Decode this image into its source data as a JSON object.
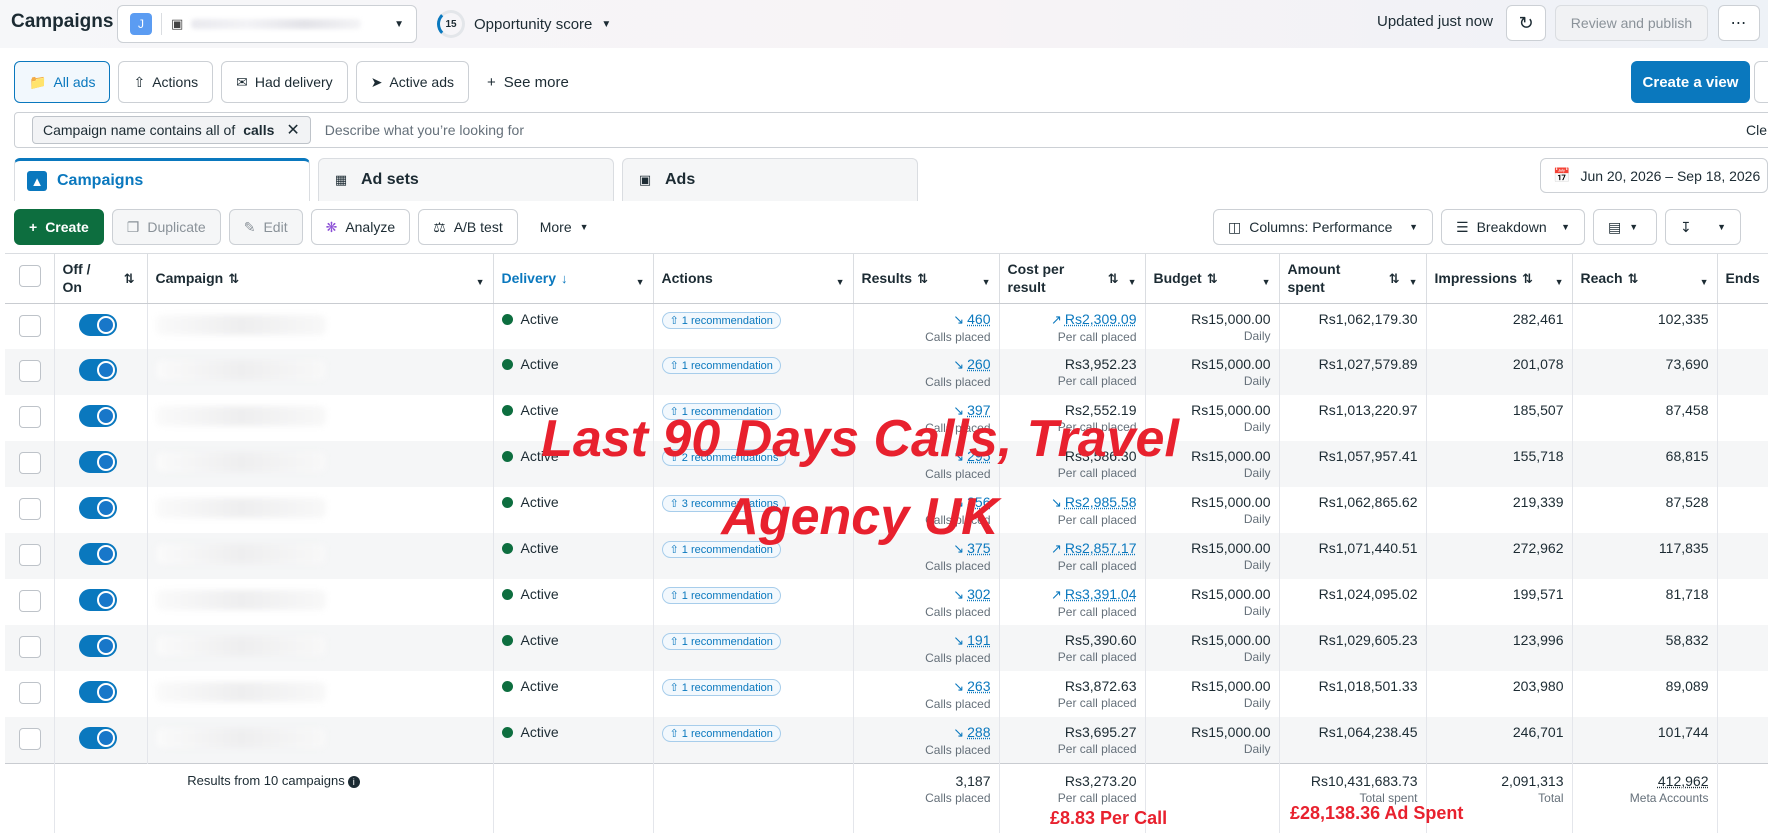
{
  "header": {
    "title": "Campaigns",
    "account_initial": "J",
    "opportunity_score": "15",
    "opportunity_label": "Opportunity score",
    "updated": "Updated just now",
    "review_label": "Review and publish",
    "more_label": "⋯"
  },
  "views": {
    "items": [
      {
        "label": "All ads"
      },
      {
        "label": "Actions"
      },
      {
        "label": "Had delivery"
      },
      {
        "label": "Active ads"
      }
    ],
    "see_more": "See more",
    "create_view": "Create a view"
  },
  "filter": {
    "chip_prefix": "Campaign name contains all of",
    "chip_value": "calls",
    "placeholder": "Describe what you’re looking for",
    "clear": "Cle"
  },
  "level_tabs": [
    {
      "label": "Campaigns"
    },
    {
      "label": "Ad sets"
    },
    {
      "label": "Ads"
    }
  ],
  "date_range": "Jun 20, 2026 – Sep 18, 2026",
  "toolbar": {
    "create": "Create",
    "duplicate": "Duplicate",
    "edit": "Edit",
    "analyze": "Analyze",
    "ab_test": "A/B test",
    "more": "More",
    "columns": "Columns: Performance",
    "breakdown": "Breakdown"
  },
  "table": {
    "headers": {
      "off_on": "Off / On",
      "campaign": "Campaign",
      "delivery": "Delivery",
      "actions": "Actions",
      "results": "Results",
      "cost": "Cost per result",
      "budget": "Budget",
      "amount": "Amount spent",
      "impressions": "Impressions",
      "reach": "Reach",
      "ends": "Ends"
    },
    "rows": [
      {
        "delivery": "Active",
        "actions": "1 recommendation",
        "results": "460",
        "results_sub": "Calls placed",
        "cost": "Rs2,309.09",
        "cost_sub": "Per call placed",
        "budget": "Rs15,000.00",
        "budget_sub": "Daily",
        "amount": "Rs1,062,179.30",
        "impressions": "282,461",
        "reach": "102,335"
      },
      {
        "delivery": "Active",
        "actions": "1 recommendation",
        "results": "260",
        "results_sub": "Calls placed",
        "cost": "Rs3,952.23",
        "cost_sub": "Per call placed",
        "budget": "Rs15,000.00",
        "budget_sub": "Daily",
        "amount": "Rs1,027,579.89",
        "impressions": "201,078",
        "reach": "73,690"
      },
      {
        "delivery": "Active",
        "actions": "1 recommendation",
        "results": "397",
        "results_sub": "Calls placed",
        "cost": "Rs2,552.19",
        "cost_sub": "Per call placed",
        "budget": "Rs15,000.00",
        "budget_sub": "Daily",
        "amount": "Rs1,013,220.97",
        "impressions": "185,507",
        "reach": "87,458"
      },
      {
        "delivery": "Active",
        "actions": "2 recommendations",
        "results": "295",
        "results_sub": "Calls placed",
        "cost": "Rs3,586.30",
        "cost_sub": "Per call placed",
        "budget": "Rs15,000.00",
        "budget_sub": "Daily",
        "amount": "Rs1,057,957.41",
        "impressions": "155,718",
        "reach": "68,815"
      },
      {
        "delivery": "Active",
        "actions": "3 recommendations",
        "results": "356",
        "results_sub": "Calls placed",
        "cost": "Rs2,985.58",
        "cost_sub": "Per call placed",
        "budget": "Rs15,000.00",
        "budget_sub": "Daily",
        "amount": "Rs1,062,865.62",
        "impressions": "219,339",
        "reach": "87,528"
      },
      {
        "delivery": "Active",
        "actions": "1 recommendation",
        "results": "375",
        "results_sub": "Calls placed",
        "cost": "Rs2,857.17",
        "cost_sub": "Per call placed",
        "budget": "Rs15,000.00",
        "budget_sub": "Daily",
        "amount": "Rs1,071,440.51",
        "impressions": "272,962",
        "reach": "117,835"
      },
      {
        "delivery": "Active",
        "actions": "1 recommendation",
        "results": "302",
        "results_sub": "Calls placed",
        "cost": "Rs3,391.04",
        "cost_sub": "Per call placed",
        "budget": "Rs15,000.00",
        "budget_sub": "Daily",
        "amount": "Rs1,024,095.02",
        "impressions": "199,571",
        "reach": "81,718"
      },
      {
        "delivery": "Active",
        "actions": "1 recommendation",
        "results": "191",
        "results_sub": "Calls placed",
        "cost": "Rs5,390.60",
        "cost_sub": "Per call placed",
        "budget": "Rs15,000.00",
        "budget_sub": "Daily",
        "amount": "Rs1,029,605.23",
        "impressions": "123,996",
        "reach": "58,832"
      },
      {
        "delivery": "Active",
        "actions": "1 recommendation",
        "results": "263",
        "results_sub": "Calls placed",
        "cost": "Rs3,872.63",
        "cost_sub": "Per call placed",
        "budget": "Rs15,000.00",
        "budget_sub": "Daily",
        "amount": "Rs1,018,501.33",
        "impressions": "203,980",
        "reach": "89,089"
      },
      {
        "delivery": "Active",
        "actions": "1 recommendation",
        "results": "288",
        "results_sub": "Calls placed",
        "cost": "Rs3,695.27",
        "cost_sub": "Per call placed",
        "budget": "Rs15,000.00",
        "budget_sub": "Daily",
        "amount": "Rs1,064,238.45",
        "impressions": "246,701",
        "reach": "101,744"
      }
    ],
    "summary": {
      "label": "Results from 10 campaigns",
      "results": "3,187",
      "results_sub": "Calls placed",
      "cost": "Rs3,273.20",
      "cost_sub": "Per call placed",
      "amount": "Rs10,431,683.73",
      "amount_sub": "Total spent",
      "impressions": "2,091,313",
      "impressions_sub": "Total",
      "reach": "412,962",
      "reach_sub": "Meta Accounts"
    }
  },
  "overlay": {
    "title": "Last 90 Days Calls, Travel Agency UK",
    "per_call": "£8.83 Per Call",
    "ad_spent": "£28,138.36 Ad Spent"
  },
  "colors": {
    "accent": "#0a78be",
    "create_green": "#0d6e3f",
    "overlay_red": "#e8212e"
  }
}
